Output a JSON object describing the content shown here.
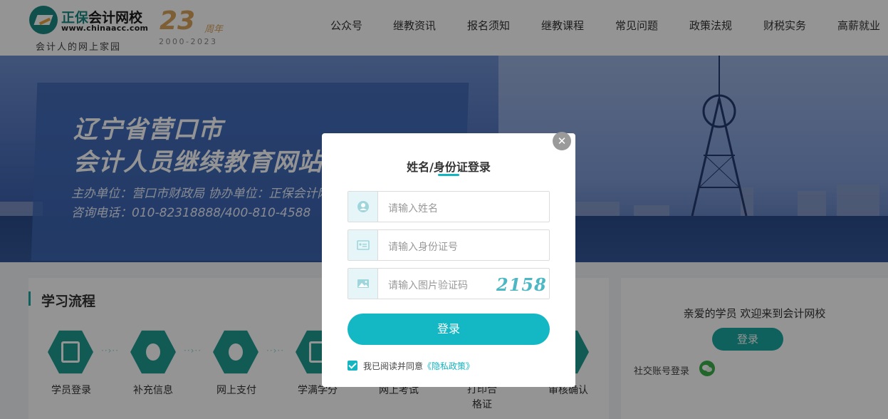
{
  "header": {
    "logo_brand": "正保",
    "logo_name": "会计网校",
    "logo_url": "www.chinaacc.com",
    "slogan": "会计人的网上家园",
    "anniversary_number": "23",
    "anniversary_label": "周年",
    "anniversary_years": "2000-2023",
    "nav": [
      "公众号",
      "继教资讯",
      "报名须知",
      "继教课程",
      "常见问题",
      "政策法规",
      "财税实务",
      "高薪就业"
    ]
  },
  "banner": {
    "line1": "辽宁省营口市",
    "line2": "会计人员继续教育网站",
    "line3": "主办单位：营口市财政局 协办单位：正保会计网校",
    "line4": "咨询电话：010-82318888/400-810-4588"
  },
  "process": {
    "title": "学习流程",
    "steps": [
      "学员登录",
      "补充信息",
      "网上支付",
      "学满学分",
      "网上考试",
      "打印合格证",
      "审核确认"
    ],
    "arrow": "··›··"
  },
  "sidebar": {
    "welcome": "亲爱的学员 欢迎来到会计网校",
    "login_label": "登录",
    "social_label": "社交账号登录"
  },
  "modal": {
    "close_symbol": "✕",
    "title": "姓名/身份证登录",
    "name_placeholder": "请输入姓名",
    "id_placeholder": "请输入身份证号",
    "captcha_placeholder": "请输入图片验证码",
    "captcha_code": "2158",
    "login_label": "登录",
    "agree_text": "我已阅读并同意",
    "privacy_link": "《隐私政策》",
    "agree_checked": true
  },
  "colors": {
    "accent": "#13b8c4",
    "teal": "#1f9b92",
    "banner_blue": "#4f72bd"
  },
  "icons": [
    "user-icon",
    "id-card-icon",
    "image-icon",
    "close-icon",
    "wechat-icon",
    "checkbox-checked-icon"
  ]
}
